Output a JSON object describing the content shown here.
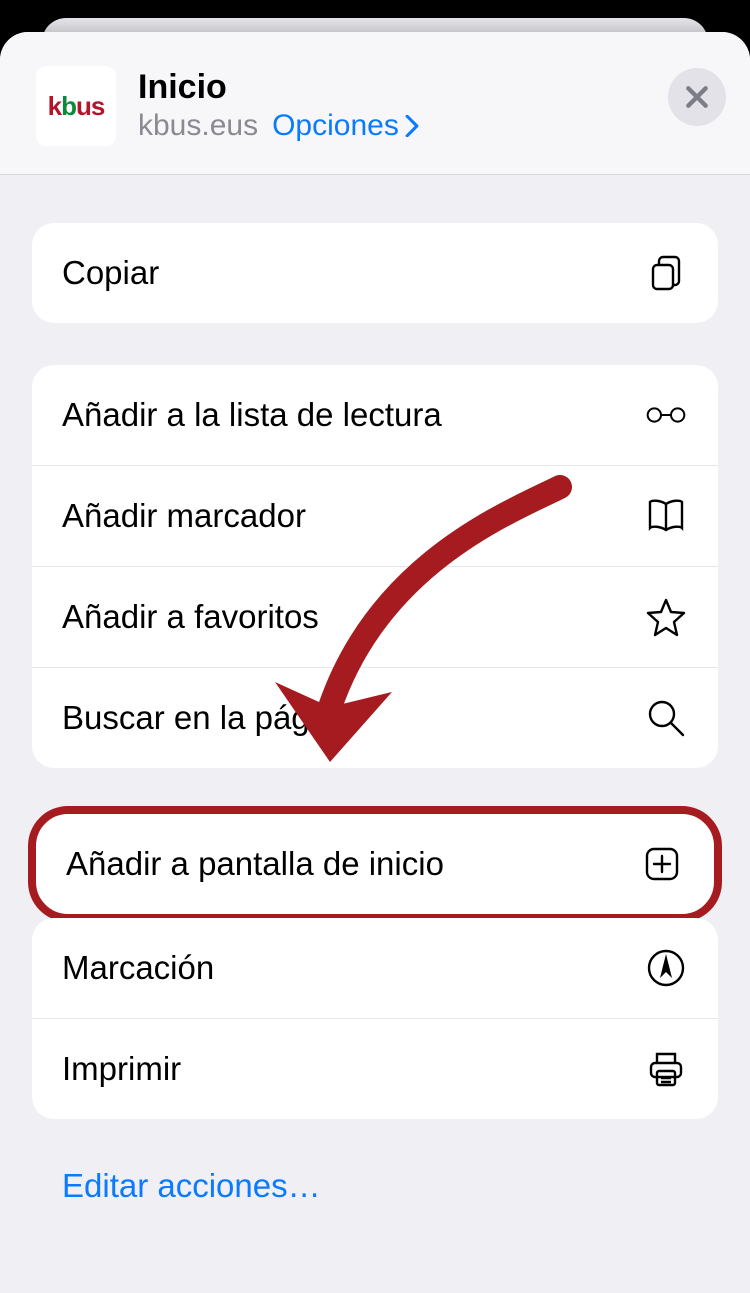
{
  "header": {
    "app_name": "kbus",
    "title": "Inicio",
    "domain": "kbus.eus",
    "options_label": "Opciones"
  },
  "actions": {
    "copy": "Copiar",
    "reading_list": "Añadir a la lista de lectura",
    "bookmark": "Añadir marcador",
    "favorites": "Añadir a favoritos",
    "find": "Buscar en la página",
    "add_home": "Añadir a pantalla de inicio",
    "markup": "Marcación",
    "print": "Imprimir"
  },
  "footer": {
    "edit_actions": "Editar acciones…"
  }
}
